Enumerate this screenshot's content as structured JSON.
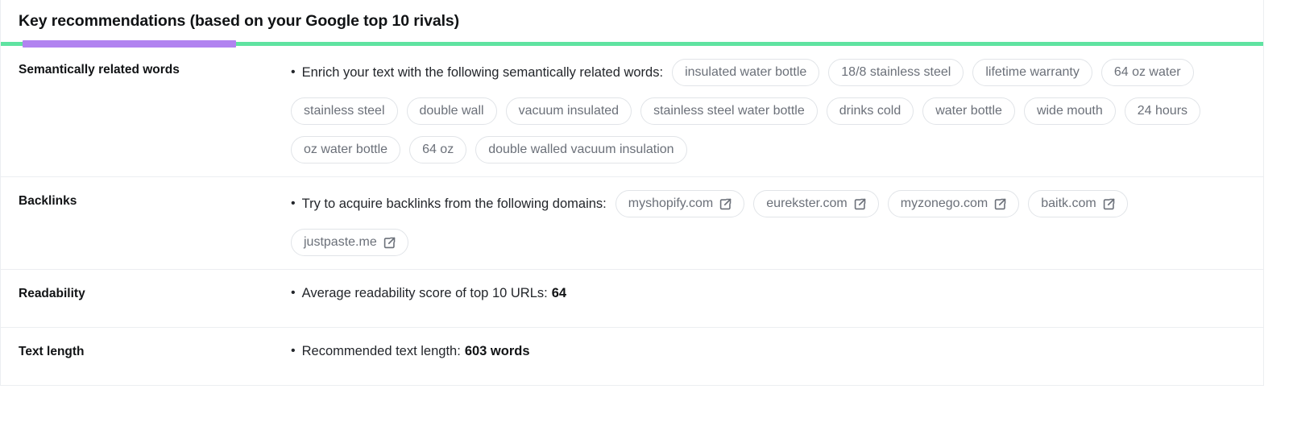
{
  "header": {
    "title": "Key recommendations (based on your Google top 10 rivals)",
    "accent_fill_color": "#b183f0",
    "accent_track_color": "#5fe3a1"
  },
  "sections": {
    "semantic": {
      "label": "Semantically related words",
      "bullet_text": "Enrich your text with the following semantically related words:",
      "tags": [
        "insulated water bottle",
        "18/8 stainless steel",
        "lifetime warranty",
        "64 oz water",
        "stainless steel",
        "double wall",
        "vacuum insulated",
        "stainless steel water bottle",
        "drinks cold",
        "water bottle",
        "wide mouth",
        "24 hours",
        "oz water bottle",
        "64 oz",
        "double walled vacuum insulation"
      ]
    },
    "backlinks": {
      "label": "Backlinks",
      "bullet_text": "Try to acquire backlinks from the following domains:",
      "domains": [
        "myshopify.com",
        "eurekster.com",
        "myzonego.com",
        "baitk.com",
        "justpaste.me"
      ],
      "icon": "external-link-icon"
    },
    "readability": {
      "label": "Readability",
      "bullet_text": "Average readability score of top 10 URLs:",
      "value": "64"
    },
    "text_length": {
      "label": "Text length",
      "bullet_text": "Recommended text length:",
      "value": "603 words"
    }
  }
}
